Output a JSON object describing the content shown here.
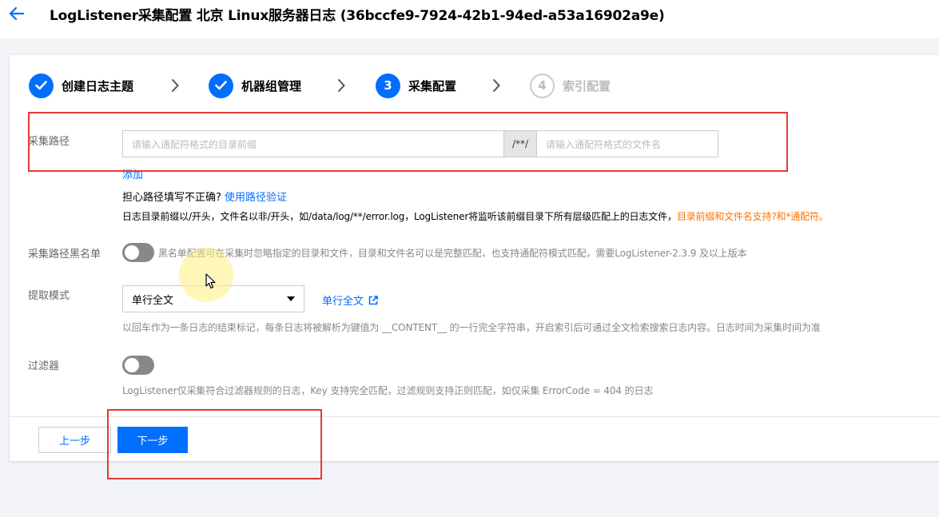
{
  "header": {
    "title": "LogListener采集配置 北京 Linux服务器日志 (36bccfe9-7924-42b1-94ed-a53a16902a9e)",
    "back_icon": "arrow-left-icon"
  },
  "steps": [
    {
      "number": "1",
      "label": "创建日志主题",
      "state": "done"
    },
    {
      "number": "2",
      "label": "机器组管理",
      "state": "done"
    },
    {
      "number": "3",
      "label": "采集配置",
      "state": "active"
    },
    {
      "number": "4",
      "label": "索引配置",
      "state": "todo"
    }
  ],
  "collect_path": {
    "label": "采集路径",
    "prefix_placeholder": "请输入通配符格式的目录前缀",
    "separator": "/**/",
    "file_placeholder": "请输入通配符格式的文件名",
    "add_label": "添加",
    "worry_text": "担心路径填写不正确?",
    "verify_link": "使用路径验证",
    "hint_text": "日志目录前缀以/开头，文件名以非/开头，如/data/log/**/error.log，LogListener将监听该前缀目录下所有层级匹配上的日志文件，",
    "hint_highlight": "目录前缀和文件名支持?和*通配符。"
  },
  "blacklist": {
    "label": "采集路径黑名单",
    "enabled": false,
    "description": "黑名单配置可在采集时忽略指定的目录和文件，目录和文件名可以是完整匹配，也支持通配符模式匹配，需要LogListener-2.3.9 及以上版本"
  },
  "extract_mode": {
    "label": "提取模式",
    "selected": "单行全文",
    "link_label": "单行全文",
    "link_icon": "external-link-icon",
    "description": "以回车作为一条日志的结束标记，每条日志将被解析为键值为 __CONTENT__ 的一行完全字符串，开启索引后可通过全文检索搜索日志内容。日志时间为采集时间为准"
  },
  "filter": {
    "label": "过滤器",
    "enabled": false,
    "description": "LogListener仅采集符合过滤器规则的日志，Key 支持完全匹配，过滤规则支持正则匹配，如仅采集 ErrorCode = 404 的日志"
  },
  "footer": {
    "prev_label": "上一步",
    "next_label": "下一步"
  },
  "colors": {
    "primary": "#006eff",
    "highlight_orange": "#ff7200",
    "annotation_red": "#e53935",
    "toggle_off": "#888888"
  }
}
